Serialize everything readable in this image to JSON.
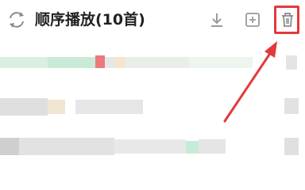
{
  "header": {
    "title": "顺序播放(10首)",
    "icons": [
      "loop-icon",
      "download-icon",
      "add-to-list-icon",
      "trash-icon"
    ]
  },
  "colors": {
    "highlight": "#e23a3a",
    "icon_gray": "#999999",
    "blur_gray": "#dcdcdc",
    "blur_green": "#bfe8cf",
    "blur_red": "#ec7a7a",
    "blur_tan": "#f3e6cc"
  }
}
